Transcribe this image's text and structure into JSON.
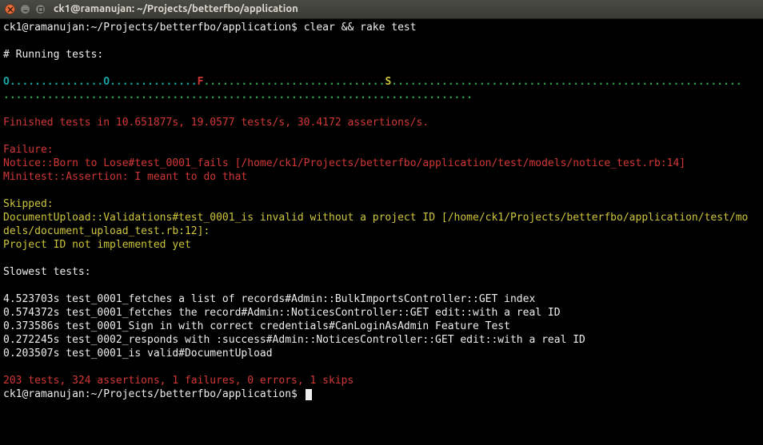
{
  "window_title": "ck1@ramanujan: ~/Projects/betterfbo/application",
  "prompt": "ck1@ramanujan:~/Projects/betterfbo/application$",
  "command": "clear && rake test",
  "running_header": "# Running tests:",
  "run_row1": {
    "seg1": "O...............O..............",
    "fail": "F",
    "seg2": ".............................",
    "skip": "S",
    "seg3": "........................................................"
  },
  "run_row2": "...........................................................................",
  "finished": "Finished tests in 10.651877s, 19.0577 tests/s, 30.4172 assertions/s.",
  "failure_header": "Failure:",
  "failure_line": "Notice::Born to Lose#test_0001_fails [/home/ck1/Projects/betterfbo/application/test/models/notice_test.rb:14]",
  "failure_msg": "Minitest::Assertion: I meant to do that",
  "skipped_header": "Skipped:",
  "skipped_line1": "DocumentUpload::Validations#test_0001_is invalid without a project ID [/home/ck1/Projects/betterfbo/application/test/mo",
  "skipped_line2": "dels/document_upload_test.rb:12]:",
  "skipped_msg": "Project ID not implemented yet",
  "slowest_header": "Slowest tests:",
  "slowest": [
    "4.523703s test_0001_fetches a list of records#Admin::BulkImportsController::GET index",
    "0.574372s test_0001_fetches the record#Admin::NoticesController::GET edit::with a real ID",
    "0.373586s test_0001_Sign in with correct credentials#CanLoginAsAdmin Feature Test",
    "0.272245s test_0002_responds with :success#Admin::NoticesController::GET edit::with a real ID",
    "0.203507s test_0001_is valid#DocumentUpload"
  ],
  "summary": "203 tests, 324 assertions, 1 failures, 0 errors, 1 skips"
}
